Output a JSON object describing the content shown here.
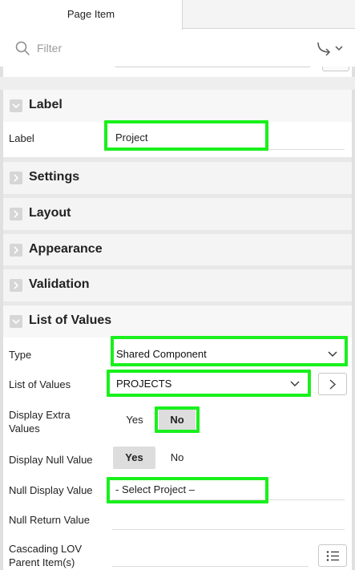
{
  "tab": {
    "active_label": "Page Item"
  },
  "filter": {
    "placeholder": "Filter"
  },
  "sections": {
    "label": {
      "title": "Label",
      "fields": {
        "label": {
          "name": "Label",
          "value": "Project"
        }
      }
    },
    "settings": {
      "title": "Settings"
    },
    "layout": {
      "title": "Layout"
    },
    "appearance": {
      "title": "Appearance"
    },
    "validation": {
      "title": "Validation"
    },
    "list_of_values": {
      "title": "List of Values",
      "fields": {
        "type": {
          "name": "Type",
          "value": "Shared Component"
        },
        "list_of_values": {
          "name": "List of Values",
          "value": "PROJECTS"
        },
        "display_extra_values": {
          "name_line1": "Display Extra",
          "name_line2": "Values",
          "options": [
            "Yes",
            "No"
          ],
          "selected": "No"
        },
        "display_null_value": {
          "name": "Display Null Value",
          "options": [
            "Yes",
            "No"
          ],
          "selected": "Yes"
        },
        "null_display_value": {
          "name": "Null Display Value",
          "value": "- Select Project –"
        },
        "null_return_value": {
          "name": "Null Return Value",
          "value": ""
        },
        "cascading_lov_parent": {
          "name_line1": "Cascading LOV",
          "name_line2": "Parent Item(s)",
          "value": ""
        }
      }
    }
  },
  "colors": {
    "highlight": "#19f01c",
    "section_bg": "#f4f4f4",
    "toggle_selected_bg": "#dddddd"
  },
  "icons": [
    "search-icon",
    "goto-arrow-icon",
    "chevron-down-icon",
    "chevron-right-icon",
    "list-icon"
  ]
}
